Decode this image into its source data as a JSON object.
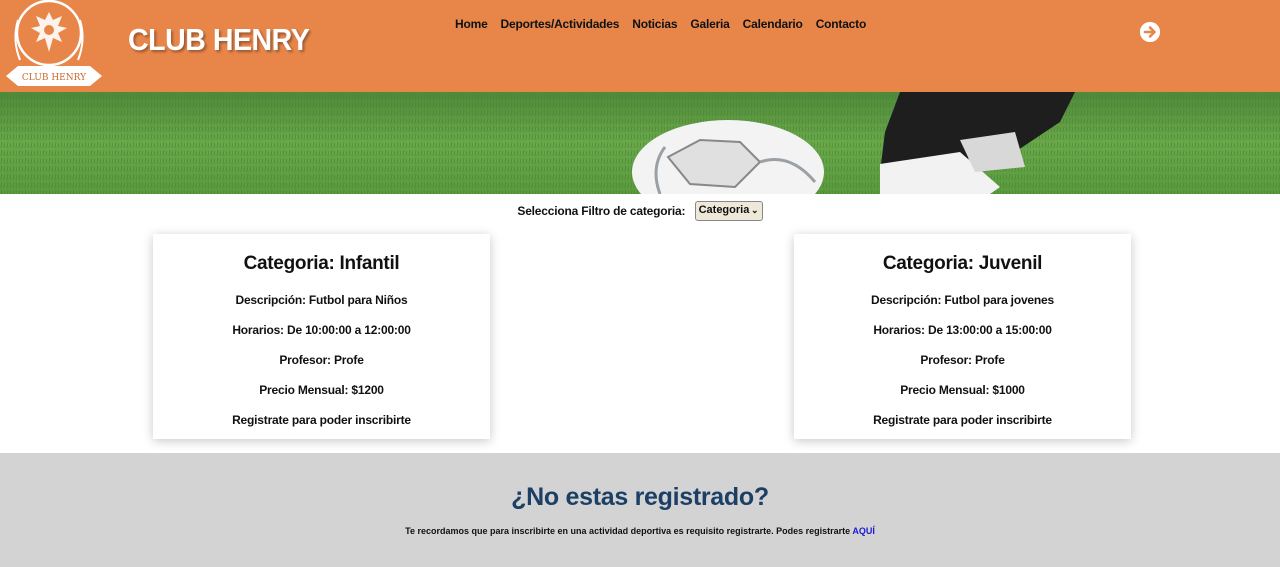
{
  "header": {
    "brand": "CLUB HENRY",
    "logo_text": "CLUB HENRY",
    "nav": [
      "Home",
      "Deportes/Actividades",
      "Noticias",
      "Galeria",
      "Calendario",
      "Contacto"
    ],
    "login_icon": "arrow-right-circle-icon",
    "background_color": "#e8864a"
  },
  "filter": {
    "label": "Selecciona Filtro de categoria:",
    "selected": "Categoria"
  },
  "cards": [
    {
      "title": "Categoria: Infantil",
      "description": "Descripción: Futbol para Niños",
      "schedule": "Horarios: De 10:00:00 a 12:00:00",
      "teacher": "Profesor: Profe",
      "price": "Precio Mensual: $1200",
      "cta": "Registrate para poder inscribirte"
    },
    {
      "title": "Categoria: Juvenil",
      "description": "Descripción: Futbol para jovenes",
      "schedule": "Horarios: De 13:00:00 a 15:00:00",
      "teacher": "Profesor: Profe",
      "price": "Precio Mensual: $1000",
      "cta": "Registrate para poder inscribirte"
    }
  ],
  "register": {
    "title": "¿No estas registrado?",
    "text": "Te recordamos que para inscribirte en una actividad deportiva es requisito registrarte. Podes registrarte",
    "link": "AQUÍ",
    "title_color": "#1c3f66",
    "link_color": "#1a1ad6"
  }
}
